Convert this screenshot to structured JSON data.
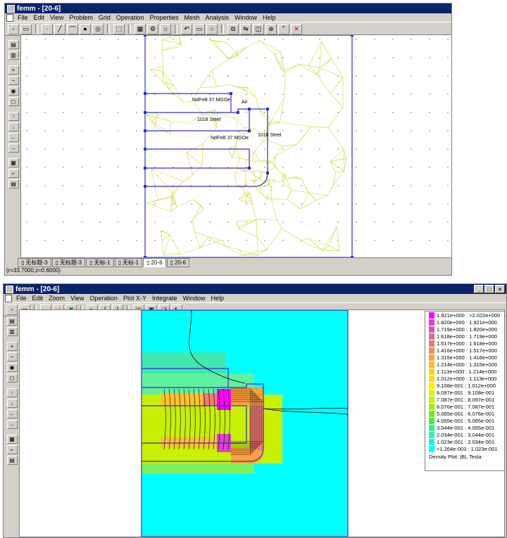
{
  "window1": {
    "title": "femm - [20-6]",
    "menu": [
      "File",
      "Edit",
      "View",
      "Problem",
      "Grid",
      "Operation",
      "Properties",
      "Mesh",
      "Analysis",
      "Window",
      "Help"
    ],
    "labels": {
      "magnet1": "NdFeB 37 MGOe",
      "air": "Air",
      "steel1": "1018 Steel",
      "magnet2": "NdFeB 37 MGOe",
      "steel2": "1018 Steel"
    },
    "tabs": [
      "无标题-3",
      "无标题-3",
      "无标-1",
      "无标-1",
      "20-6",
      "20-6"
    ],
    "status": "(r=33.7000,z=0.6000)"
  },
  "window2": {
    "title": "femm - [20-6]",
    "menu": [
      "File",
      "Edit",
      "Zoom",
      "View",
      "Operation",
      "Plot X-Y",
      "Integrate",
      "Window",
      "Help"
    ],
    "legend": {
      "rows": [
        {
          "label": "1.921e+000 : >2.022e+000",
          "color": "#ff00ff"
        },
        {
          "label": "1.820e+000 : 1.921e+000",
          "color": "#e040d0"
        },
        {
          "label": "1.719e+000 : 1.820e+000",
          "color": "#d05ab0"
        },
        {
          "label": "1.618e+000 : 1.719e+000",
          "color": "#e06a90"
        },
        {
          "label": "1.517e+000 : 1.618e+000",
          "color": "#f07a70"
        },
        {
          "label": "1.416e+000 : 1.517e+000",
          "color": "#f89050"
        },
        {
          "label": "1.315e+000 : 1.416e+000",
          "color": "#ffa040"
        },
        {
          "label": "1.214e+000 : 1.315e+000",
          "color": "#ffb830"
        },
        {
          "label": "1.113e+000 : 1.214e+000",
          "color": "#ffd020"
        },
        {
          "label": "1.012e+000 : 1.113e+000",
          "color": "#ffe010"
        },
        {
          "label": "9.108e-001 : 1.012e+000",
          "color": "#fff000"
        },
        {
          "label": "8.097e-001 : 9.108e-001",
          "color": "#e0f000"
        },
        {
          "label": "7.087e-001 : 8.097e-001",
          "color": "#c8f000"
        },
        {
          "label": "6.076e-001 : 7.087e-001",
          "color": "#a0f000"
        },
        {
          "label": "5.065e-001 : 6.076e-001",
          "color": "#70f000"
        },
        {
          "label": "4.055e-001 : 5.065e-001",
          "color": "#40f040"
        },
        {
          "label": "3.044e-001 : 4.055e-001",
          "color": "#30f090"
        },
        {
          "label": "2.034e-001 : 3.044e-001",
          "color": "#30f0c0"
        },
        {
          "label": "1.023e-001 : 2.034e-001",
          "color": "#20f0e0"
        },
        {
          "label": "<1.264e-003 : 1.023e-001",
          "color": "#00ffff"
        }
      ],
      "title": "Density Plot: |B|, Tesla"
    }
  }
}
